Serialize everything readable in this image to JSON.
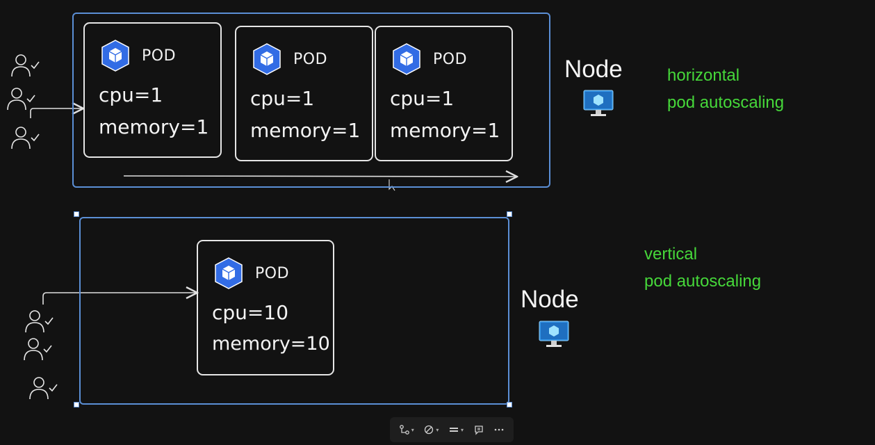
{
  "colors": {
    "background": "#121212",
    "node_border": "#5b8fd6",
    "pod_border": "#e6e6e6",
    "accent_green": "#46d83a",
    "k8s_blue": "#326ce5"
  },
  "horizontal": {
    "node_label": "Node",
    "caption_line1": "horizontal",
    "caption_line2": "pod autoscaling",
    "pods": [
      {
        "label": "POD",
        "cpu": "cpu=1",
        "memory": "memory=1"
      },
      {
        "label": "POD",
        "cpu": "cpu=1",
        "memory": "memory=1"
      },
      {
        "label": "POD",
        "cpu": "cpu=1",
        "memory": "memory=1"
      }
    ]
  },
  "vertical": {
    "node_label": "Node",
    "caption_line1": "vertical",
    "caption_line2": "pod autoscaling",
    "pod": {
      "label": "POD",
      "cpu": "cpu=10",
      "memory": "memory=10"
    }
  },
  "icons": {
    "pod": "kubernetes-pod-hexagon-icon",
    "node": "monitor-icon",
    "user": "user-check-icon"
  },
  "toolbar": {
    "items": [
      "connector-tool-icon",
      "style-tool-icon",
      "fill-tool-icon",
      "comment-icon",
      "more-icon"
    ]
  }
}
